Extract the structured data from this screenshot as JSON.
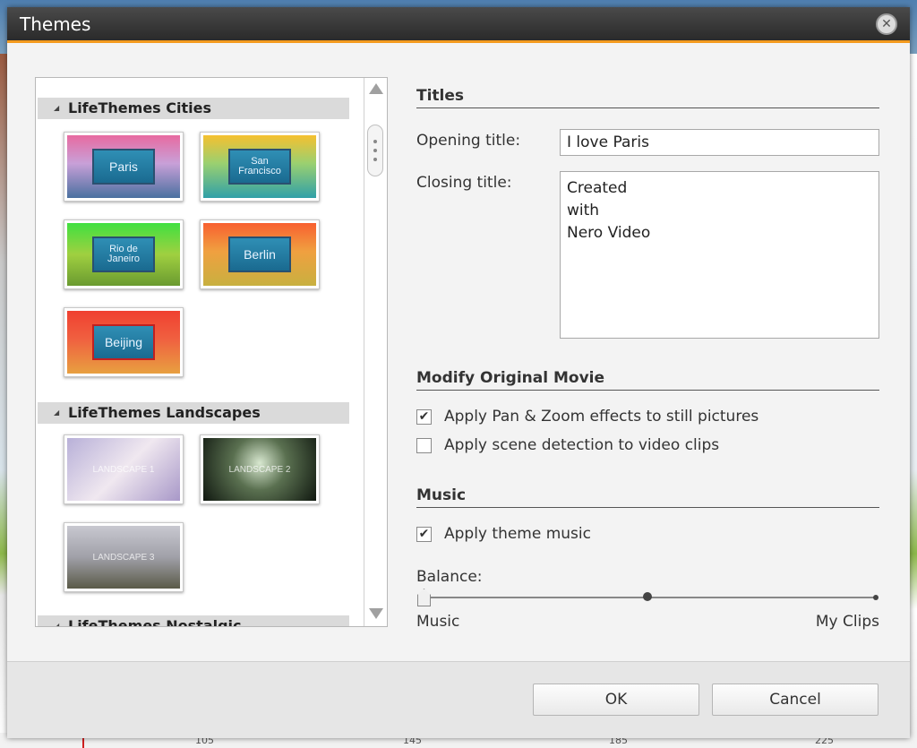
{
  "window": {
    "title": "Themes"
  },
  "theme_list": {
    "groups": [
      {
        "label": "LifeThemes Cities",
        "items": [
          {
            "label": "Paris"
          },
          {
            "label": "San Francisco"
          },
          {
            "label": "Rio de Janeiro"
          },
          {
            "label": "Berlin"
          },
          {
            "label": "Beijing"
          }
        ]
      },
      {
        "label": "LifeThemes Landscapes",
        "items": [
          {
            "label": "LANDSCAPE 1"
          },
          {
            "label": "LANDSCAPE 2"
          },
          {
            "label": "LANDSCAPE 3"
          }
        ]
      },
      {
        "label": "LifeThemes Nostalgic"
      }
    ]
  },
  "titles": {
    "heading": "Titles",
    "opening_label": "Opening title:",
    "opening_value": "I love Paris",
    "closing_label": "Closing title:",
    "closing_lines": [
      "Created",
      "with",
      "Nero Video"
    ]
  },
  "modify": {
    "heading": "Modify Original Movie",
    "pan_zoom": {
      "label": "Apply Pan & Zoom effects to still pictures",
      "checked": true
    },
    "scene_detection": {
      "label": "Apply scene detection to video clips",
      "checked": false
    }
  },
  "music": {
    "heading": "Music",
    "theme_music": {
      "label": "Apply theme music",
      "checked": true
    },
    "balance_label": "Balance:",
    "balance_value": 0,
    "left_label": "Music",
    "right_label": "My Clips"
  },
  "buttons": {
    "ok": "OK",
    "cancel": "Cancel"
  },
  "background_ticks": [
    "105",
    "145",
    "185",
    "225"
  ],
  "colors": {
    "accent": "#f39a1e",
    "titlebar": "#333333"
  }
}
